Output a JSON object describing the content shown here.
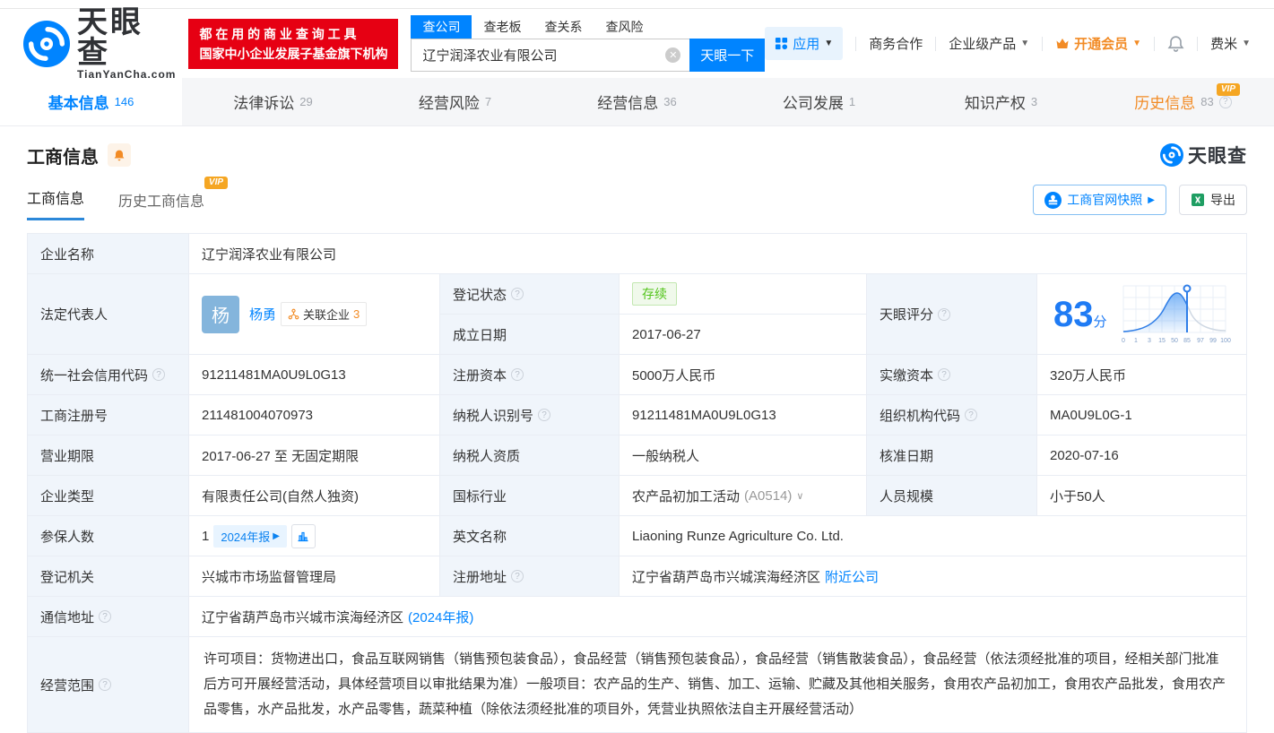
{
  "header": {
    "logo": {
      "title": "天眼查",
      "subtitle": "TianYanCha.com"
    },
    "promo": {
      "line1": "都 在 用 的 商 业 查 询 工 具",
      "line2": "国家中小企业发展子基金旗下机构"
    },
    "search": {
      "tabs": [
        {
          "label": "查公司"
        },
        {
          "label": "查老板"
        },
        {
          "label": "查关系"
        },
        {
          "label": "查风险"
        }
      ],
      "value": "辽宁润泽农业有限公司",
      "button": "天眼一下"
    },
    "nav": {
      "apps": "应用",
      "cooperation": "商务合作",
      "enterprise": "企业级产品",
      "vip": "开通会员",
      "username": "费米"
    }
  },
  "tabs": [
    {
      "label": "基本信息",
      "count": "146"
    },
    {
      "label": "法律诉讼",
      "count": "29"
    },
    {
      "label": "经营风险",
      "count": "7"
    },
    {
      "label": "经营信息",
      "count": "36"
    },
    {
      "label": "公司发展",
      "count": "1"
    },
    {
      "label": "知识产权",
      "count": "3"
    },
    {
      "label": "历史信息",
      "count": "83",
      "vip": "VIP"
    }
  ],
  "section": {
    "title": "工商信息",
    "subtabs": [
      {
        "label": "工商信息"
      },
      {
        "label": "历史工商信息",
        "vip": "VIP"
      }
    ],
    "snapshot_button": "工商官网快照",
    "export_button": "导出",
    "watermark": "天眼查"
  },
  "table": {
    "company_name": {
      "label": "企业名称",
      "value": "辽宁润泽农业有限公司"
    },
    "legal_rep": {
      "label": "法定代表人",
      "avatar": "杨",
      "name": "杨勇",
      "related_label": "关联企业",
      "related_count": "3"
    },
    "reg_status": {
      "label": "登记状态",
      "value": "存续"
    },
    "establish_date": {
      "label": "成立日期",
      "value": "2017-06-27"
    },
    "score": {
      "label": "天眼评分",
      "value": "83",
      "unit": "分",
      "xticks": [
        "0",
        "1",
        "3",
        "15",
        "50",
        "85",
        "97",
        "99",
        "100"
      ]
    },
    "credit_code": {
      "label": "统一社会信用代码",
      "value": "91211481MA0U9L0G13"
    },
    "reg_capital": {
      "label": "注册资本",
      "value": "5000万人民币"
    },
    "paid_capital": {
      "label": "实缴资本",
      "value": "320万人民币"
    },
    "reg_number": {
      "label": "工商注册号",
      "value": "211481004070973"
    },
    "taxpayer_id": {
      "label": "纳税人识别号",
      "value": "91211481MA0U9L0G13"
    },
    "org_code": {
      "label": "组织机构代码",
      "value": "MA0U9L0G-1"
    },
    "business_term": {
      "label": "营业期限",
      "value": "2017-06-27 至 无固定期限"
    },
    "taxpayer_quality": {
      "label": "纳税人资质",
      "value": "一般纳税人"
    },
    "approval_date": {
      "label": "核准日期",
      "value": "2020-07-16"
    },
    "company_type": {
      "label": "企业类型",
      "value": "有限责任公司(自然人独资)"
    },
    "industry": {
      "label": "国标行业",
      "value": "农产品初加工活动",
      "code": "(A0514)"
    },
    "staff_size": {
      "label": "人员规模",
      "value": "小于50人"
    },
    "insured": {
      "label": "参保人数",
      "value": "1",
      "badge": "2024年报"
    },
    "english_name": {
      "label": "英文名称",
      "value": "Liaoning Runze Agriculture Co. Ltd."
    },
    "reg_authority": {
      "label": "登记机关",
      "value": "兴城市市场监督管理局"
    },
    "reg_address": {
      "label": "注册地址",
      "value": "辽宁省葫芦岛市兴城滨海经济区",
      "link": "附近公司"
    },
    "postal_address": {
      "label": "通信地址",
      "value": "辽宁省葫芦岛市兴城市滨海经济区",
      "link": "(2024年报)"
    },
    "business_scope": {
      "label": "经营范围",
      "value": "许可项目：货物进出口，食品互联网销售（销售预包装食品），食品经营（销售预包装食品），食品经营（销售散装食品），食品经营（依法须经批准的项目，经相关部门批准后方可开展经营活动，具体经营项目以审批结果为准）一般项目：农产品的生产、销售、加工、运输、贮藏及其他相关服务，食用农产品初加工，食用农产品批发，食用农产品零售，水产品批发，水产品零售，蔬菜种植（除依法须经批准的项目外，凭营业执照依法自主开展经营活动）"
    }
  }
}
